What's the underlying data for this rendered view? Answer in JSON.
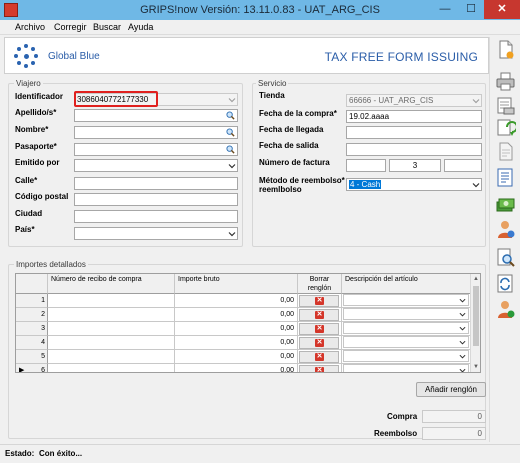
{
  "window": {
    "title": "GRIPS!now Versión: 13.11.0.83 - UAT_ARG_CIS",
    "controls": {
      "minimize": "—",
      "maximize": "☐",
      "close": "✕"
    }
  },
  "menu": [
    "Archivo",
    "Corregir",
    "Buscar",
    "Ayuda"
  ],
  "header": {
    "logo_text": "Global Blue",
    "title": "TAX FREE FORM ISSUING"
  },
  "viajero": {
    "title": "Viajero",
    "fields": [
      {
        "label": "Identificador",
        "value": "3086040772177330",
        "type": "dropdown-disabled"
      },
      {
        "label": "Apellido/s*",
        "value": "",
        "type": "search"
      },
      {
        "label": "Nombre*",
        "value": "",
        "type": "search"
      },
      {
        "label": "Pasaporte*",
        "value": "",
        "type": "search"
      },
      {
        "label": "Emitido por",
        "value": "",
        "type": "dropdown"
      },
      {
        "label": "Calle*",
        "value": "",
        "type": "text"
      },
      {
        "label": "Código postal",
        "value": "",
        "type": "text"
      },
      {
        "label": "Ciudad",
        "value": "",
        "type": "text"
      },
      {
        "label": "País*",
        "value": "",
        "type": "dropdown"
      }
    ]
  },
  "servicio": {
    "title": "Servicio",
    "tienda_label": "Tienda",
    "tienda_value": "66666 - UAT_ARG_CIS",
    "fecha_compra_label": "Fecha de la compra*",
    "fecha_compra_value": "19.02.aaaa",
    "fecha_llegada_label": "Fecha de llegada",
    "fecha_salida_label": "Fecha de salida",
    "factura_label": "Número de factura",
    "factura_parts": [
      "",
      "3",
      ""
    ],
    "reembolso_label_1": "Método de reembolso*",
    "reembolso_label_2": "reemlbolso",
    "reembolso_value": "4 - Cash"
  },
  "importes": {
    "title": "Importes detallados",
    "columns": [
      "Número de recibo de compra",
      "Importe bruto",
      "Borrar renglón",
      "Descripción del artículo"
    ],
    "rows": [
      {
        "num": "1",
        "amount": "0,00"
      },
      {
        "num": "2",
        "amount": "0,00"
      },
      {
        "num": "3",
        "amount": "0,00"
      },
      {
        "num": "4",
        "amount": "0,00"
      },
      {
        "num": "5",
        "amount": "0,00"
      },
      {
        "num": "6",
        "amount": "0,00"
      }
    ],
    "current_row_marker": "▶",
    "add_row_button": "Añadir renglón"
  },
  "totals": {
    "compra_label": "Compra",
    "compra_value": "0",
    "reembolso_label": "Reembolso",
    "reembolso_value": "0"
  },
  "status": {
    "label": "Estado:",
    "value": "Con éxito..."
  },
  "toolbar_icons": [
    "new-document-icon",
    "print-icon",
    "print-preview-icon",
    "refresh-icon",
    "document-icon",
    "list-document-icon",
    "money-icon",
    "user-icon",
    "search-document-icon",
    "sync-document-icon",
    "user-refresh-icon"
  ],
  "colors": {
    "brand_blue": "#2a5da8",
    "highlight_red": "#e0201e",
    "selection_blue": "#0078d7"
  }
}
